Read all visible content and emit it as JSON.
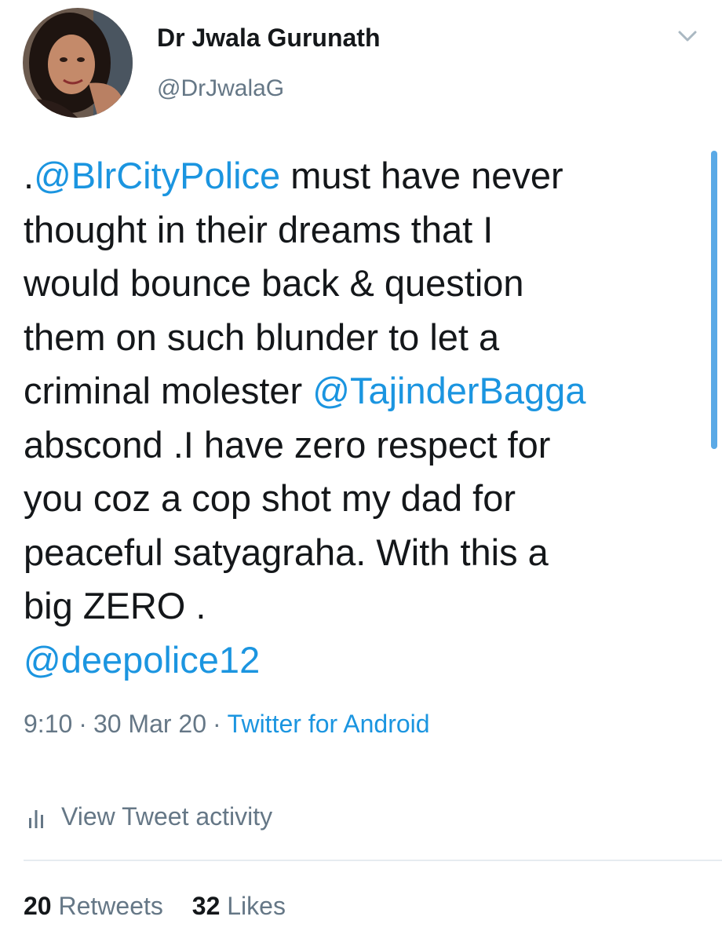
{
  "user": {
    "display_name": "Dr Jwala Gurunath",
    "handle": "@DrJwalaG"
  },
  "tweet": {
    "line1_prefix": ".",
    "mention_1": "@BlrCityPolice",
    "line1_suffix": " must have never",
    "line2": "thought in their dreams that I",
    "line3": "would bounce back & question",
    "line4": "them on such blunder to let a",
    "line5_prefix": "criminal molester ",
    "mention_2": "@TajinderBagga",
    "line6": "abscond .I have zero respect for",
    "line7": "you coz a cop shot my dad for",
    "line8": "peaceful satyagraha. With this a",
    "line9": "big ZERO .",
    "mention_3": "@deepolice12"
  },
  "meta": {
    "time": "9:10",
    "separator": "·",
    "date": "30 Mar 20",
    "source": "Twitter for Android"
  },
  "activity": {
    "label": "View Tweet activity",
    "icon": "bar-chart-icon"
  },
  "stats": {
    "retweets_count": "20",
    "retweets_label": "Retweets",
    "likes_count": "32",
    "likes_label": "Likes"
  },
  "icons": {
    "caret": "chevron-down-icon"
  },
  "colors": {
    "link": "#1b95e0",
    "secondary_text": "#657786",
    "primary_text": "#14171a",
    "divider": "#e6ecf0",
    "scrollbar": "#5aa9e6"
  }
}
